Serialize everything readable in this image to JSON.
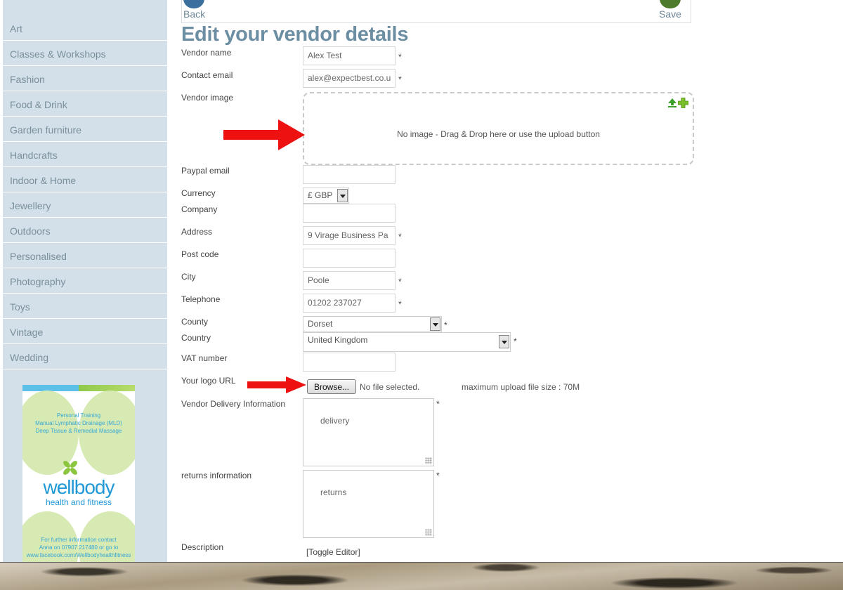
{
  "sidebar": {
    "categories": [
      "Art",
      "Classes & Workshops",
      "Fashion",
      "Food & Drink",
      "Garden furniture",
      "Handcrafts",
      "Indoor & Home",
      "Jewellery",
      "Outdoors",
      "Personalised",
      "Photography",
      "Toys",
      "Vintage",
      "Wedding"
    ]
  },
  "ad": {
    "services": "Personal Training\nManual Lymphatic Drainage (MLD)\nDeep Tissue & Remedial Massage",
    "brand": "wellbody",
    "tagline": "health and fitness",
    "contact": "For further information contact\nAnna on 07907 217480 or go to\nwww.facebook.com/Wellbodyhealthfitness"
  },
  "toolbar": {
    "back_label": "Back",
    "save_label": "Save"
  },
  "page": {
    "title": "Edit your vendor details"
  },
  "form": {
    "vendor_name": {
      "label": "Vendor name",
      "value": "Alex Test"
    },
    "contact_email": {
      "label": "Contact email",
      "value": "alex@expectbest.co.u"
    },
    "vendor_image": {
      "label": "Vendor image",
      "dropzone_text": "No image - Drag & Drop here or use the upload button"
    },
    "paypal_email": {
      "label": "Paypal email",
      "value": ""
    },
    "currency": {
      "label": "Currency",
      "value": "£ GBP"
    },
    "company": {
      "label": "Company",
      "value": ""
    },
    "address": {
      "label": "Address",
      "value": "9 Virage Business Pa"
    },
    "post_code": {
      "label": "Post code",
      "value": ""
    },
    "city": {
      "label": "City",
      "value": "Poole"
    },
    "telephone": {
      "label": "Telephone",
      "value": "01202 237027"
    },
    "county": {
      "label": "County",
      "value": "Dorset"
    },
    "country": {
      "label": "Country",
      "value": "United Kingdom"
    },
    "vat_number": {
      "label": "VAT number",
      "value": ""
    },
    "logo_url": {
      "label": "Your logo URL",
      "browse_label": "Browse...",
      "file_status": "No file selected.",
      "max_size": "maximum upload file size : 70M"
    },
    "delivery": {
      "label": "Vendor Delivery Information",
      "value": "delivery"
    },
    "returns": {
      "label": "returns information",
      "value": "returns"
    },
    "description": {
      "label": "Description",
      "toggle_editor": "[Toggle Editor]"
    },
    "required_marker": "*"
  },
  "colors": {
    "sidebar_bg": "#d3e0e9",
    "title": "#6b8ea3",
    "annotation_arrow": "#ee1111"
  },
  "icons": [
    "back-icon",
    "save-icon",
    "upload-icon",
    "add-icon",
    "arrow-annotation-icon",
    "dropdown-arrow-icon",
    "resize-grip-icon"
  ]
}
